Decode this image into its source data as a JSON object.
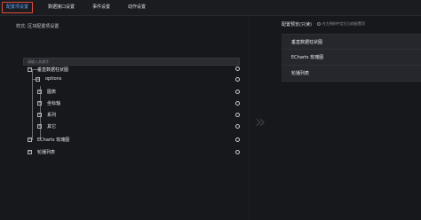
{
  "tabs": [
    {
      "label": "配置项设置"
    },
    {
      "label": "数据接口设置"
    },
    {
      "label": "事件设置"
    },
    {
      "label": "动作设置"
    }
  ],
  "left": {
    "hint": "样式: 区块配置项设置",
    "search_placeholder": "请输入关键字",
    "tree": [
      {
        "label": "垂直数据柱状图"
      },
      {
        "label": "options"
      },
      {
        "label": "图表"
      },
      {
        "label": "坐标轴"
      },
      {
        "label": "系列"
      },
      {
        "label": "其它"
      },
      {
        "label": "ECharts 玫瑰图"
      },
      {
        "label": "轮播列表"
      }
    ]
  },
  "right": {
    "title": "配置预览(只读)",
    "checkbox_label": "在左侧树中定位当前配置项",
    "items": [
      {
        "label": "垂直数据柱状图"
      },
      {
        "label": "ECharts 玫瑰图"
      },
      {
        "label": "轮播列表"
      }
    ]
  },
  "icons": {
    "expand": "plus-box-icon",
    "collapse": "minus-box-icon",
    "radio": "radio-icon",
    "arrow": "chevron-right-double-icon"
  }
}
